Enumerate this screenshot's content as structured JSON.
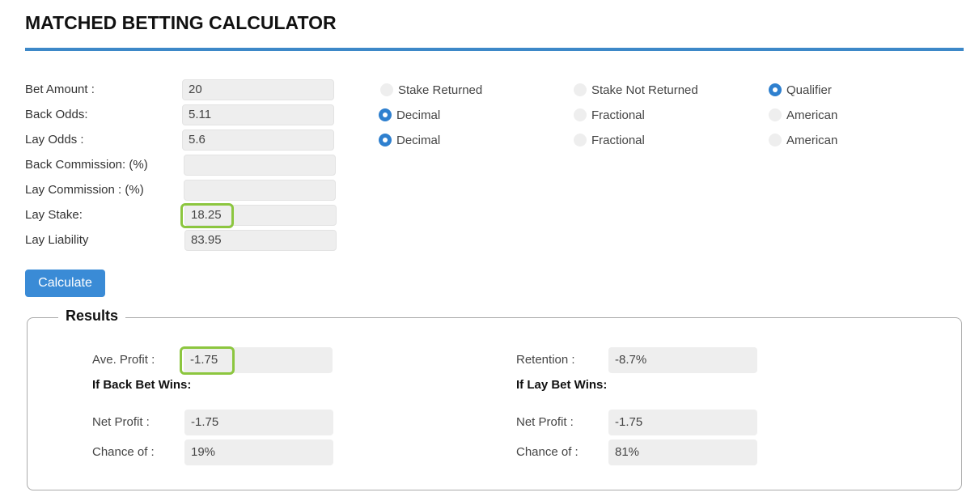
{
  "header": {
    "title": "MATCHED BETTING CALCULATOR"
  },
  "inputs": {
    "bet_amount": {
      "label": "Bet Amount :",
      "value": "20"
    },
    "back_odds": {
      "label": "Back Odds:",
      "value": "5.11"
    },
    "lay_odds": {
      "label": "Lay Odds :",
      "value": "5.6"
    },
    "back_commission": {
      "label": "Back Commission: (%)",
      "value": ""
    },
    "lay_commission": {
      "label": "Lay Commission : (%)",
      "value": ""
    },
    "lay_stake": {
      "label": "Lay Stake:",
      "value": "18.25",
      "highlighted": true
    },
    "lay_liability": {
      "label": "Lay Liability",
      "value": "83.95"
    }
  },
  "options": {
    "bet_type": [
      {
        "label": "Stake Returned",
        "checked": false
      },
      {
        "label": "Stake Not Returned",
        "checked": false
      },
      {
        "label": "Qualifier",
        "checked": true
      }
    ],
    "back_odds_format": [
      {
        "label": "Decimal",
        "checked": true
      },
      {
        "label": "Fractional",
        "checked": false
      },
      {
        "label": "American",
        "checked": false
      }
    ],
    "lay_odds_format": [
      {
        "label": "Decimal",
        "checked": true
      },
      {
        "label": "Fractional",
        "checked": false
      },
      {
        "label": "American",
        "checked": false
      }
    ]
  },
  "actions": {
    "calculate_label": "Calculate"
  },
  "results": {
    "legend": "Results",
    "ave_profit": {
      "label": "Ave. Profit :",
      "value": "-1.75",
      "highlighted": true
    },
    "retention": {
      "label": "Retention :",
      "value": "-8.7%"
    },
    "back_wins": {
      "heading": "If Back Bet Wins:",
      "net_profit": {
        "label": "Net Profit :",
        "value": "-1.75"
      },
      "chance": {
        "label": "Chance of :",
        "value": "19%"
      }
    },
    "lay_wins": {
      "heading": "If Lay Bet Wins:",
      "net_profit": {
        "label": "Net Profit :",
        "value": "-1.75"
      },
      "chance": {
        "label": "Chance of :",
        "value": "81%"
      }
    }
  },
  "colors": {
    "accent": "#3d88c8",
    "button": "#3a8bd6",
    "highlight": "#8cc63f",
    "field_bg": "#eeeeee"
  }
}
